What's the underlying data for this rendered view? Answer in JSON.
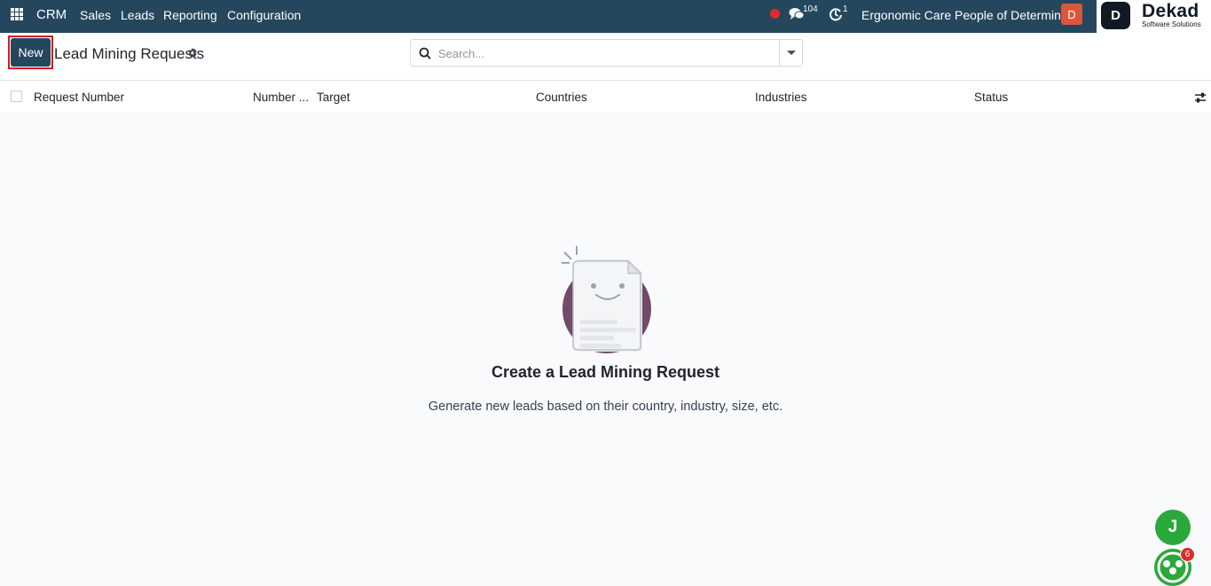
{
  "navbar": {
    "app_name": "CRM",
    "menu": [
      "Sales",
      "Leads",
      "Reporting",
      "Configuration"
    ],
    "chat_count": "104",
    "activity_count": "1",
    "company_name": "Ergonomic Care People of Determina...",
    "user_initial": "D",
    "logo_mark": "D",
    "logo_title": "Dekad",
    "logo_subtitle": "Software Solutions",
    "colors": {
      "background": "#25475e",
      "record_dot": "#e02b2b",
      "avatar": "#d9573b"
    }
  },
  "control_panel": {
    "new_label": "New",
    "title": "Lead Mining Requests",
    "search_placeholder": "Search..."
  },
  "list": {
    "columns": [
      "Request Number",
      "Number ...",
      "Target",
      "Countries",
      "Industries",
      "Status"
    ]
  },
  "empty_state": {
    "title": "Create a Lead Mining Request",
    "description": "Generate new leads based on their country, industry, size, etc."
  },
  "floating": {
    "user_initial": "J",
    "chat_badge": "6",
    "color": "#2aa83a"
  }
}
